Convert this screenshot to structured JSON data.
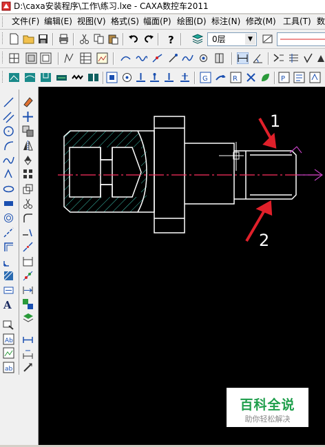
{
  "window": {
    "title": "D:\\caxa安装程序\\工作\\练习.lxe - CAXA数控车2011"
  },
  "menu": [
    "文件(F)",
    "编辑(E)",
    "视图(V)",
    "格式(S)",
    "幅面(P)",
    "绘图(D)",
    "标注(N)",
    "修改(M)",
    "工具(T)",
    "数"
  ],
  "layer": {
    "value": "0层"
  },
  "annotations": {
    "label1": "1",
    "label2": "2"
  },
  "watermark": {
    "main": "百科全说",
    "sub": "助你轻松解决"
  },
  "colors": {
    "canvas": "#000000",
    "outline": "#ffffff",
    "centerline": "#ff3060",
    "hatch": "#3fc7b5",
    "arrows": "#e0202a",
    "axis_arrow": "#c040c0"
  }
}
